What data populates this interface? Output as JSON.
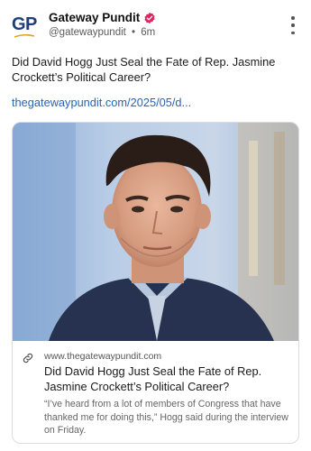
{
  "post": {
    "author": {
      "name": "Gateway Pundit",
      "avatar_text": "GP",
      "handle": "@gatewaypundit",
      "separator": "•",
      "time": "6m"
    },
    "text": "Did David Hogg Just Seal the Fate of Rep. Jasmine Crockett’s Political Career?",
    "link": "thegatewaypundit.com/2025/05/d..."
  },
  "card": {
    "domain": "www.thegatewaypundit.com",
    "title": "Did David Hogg Just Seal the Fate of Rep. Jasmine Crockett’s Political Career?",
    "description": "“I’ve heard from a lot of members of Congress that have thanked me for doing this,” Hogg said during the interview on Friday."
  },
  "icons": {
    "verified": "verified-badge-icon",
    "menu": "more-vertical-icon",
    "link": "link-icon"
  },
  "colors": {
    "brand_navy": "#1f3f7a",
    "brand_gold": "#e0a424",
    "verified": "#e0245e",
    "link": "#2a62b8"
  }
}
